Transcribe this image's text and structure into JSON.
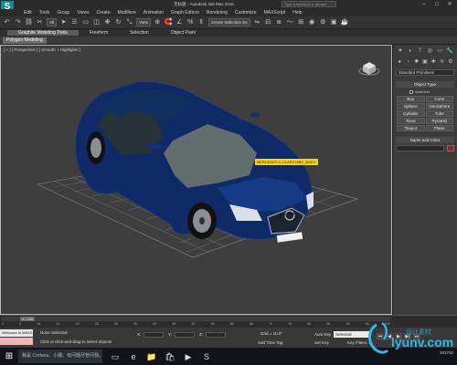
{
  "app": {
    "logo": "S",
    "title": "无标题 - Autodesk 3ds Max 2016",
    "search_placeholder": "Type a keyword or phrase",
    "window_buttons": [
      "–",
      "□",
      "✕"
    ]
  },
  "menu": [
    "Edit",
    "Tools",
    "Group",
    "Views",
    "Create",
    "Modifiers",
    "Animation",
    "Graph Editors",
    "Rendering",
    "Customize",
    "MAXScript",
    "Help"
  ],
  "toolbar": {
    "filter_select": "All",
    "refcoord_select": "View",
    "named_sel": "Create Selection Se"
  },
  "ribbon": {
    "tabs": [
      "Graphite Modeling Tools",
      "Freeform",
      "Selection",
      "Object Paint"
    ],
    "active_index": 0,
    "sub_panel": "Polygon Modeling"
  },
  "viewport": {
    "label": "[ + ] [ Perspective ] [ Smooth + Highlights ]",
    "car_tag": "MERCEDES C-CLASS MBC_BODY",
    "plate": "S·CL 6111"
  },
  "command_panel": {
    "category_dropdown": "Standard Primitives",
    "object_type_header": "Object Type",
    "autogrid_label": "AutoGrid",
    "objects": [
      "Box",
      "Cone",
      "Sphere",
      "GeoSphere",
      "Cylinder",
      "Tube",
      "Torus",
      "Pyramid",
      "Teapot",
      "Plane"
    ],
    "name_color_header": "Name and Color",
    "swatch_color": "#9a1b2c"
  },
  "timeline": {
    "frame_indicator": "0 / 100",
    "ticks": [
      "0",
      "5",
      "10",
      "15",
      "20",
      "25",
      "30",
      "35",
      "40",
      "45",
      "50",
      "55",
      "60",
      "65",
      "70",
      "75",
      "80",
      "85",
      "90",
      "95",
      "100"
    ]
  },
  "status": {
    "maxscript_in": "Welcome to MAXS",
    "maxscript_out": "",
    "selection_status": "None Selected",
    "prompt": "Click or click-and-drag to select objects",
    "x_label": "X:",
    "y_label": "Y:",
    "z_label": "Z:",
    "grid": "Grid = 10.0\"",
    "add_time_tag": "Add Time Tag",
    "auto_key": "Auto Key",
    "set_key": "Set Key",
    "selected_dropdown": "Selected",
    "key_filters": "Key Filters...",
    "play_controls": [
      "⏮",
      "◀",
      "▶",
      "▶|",
      "⏭"
    ]
  },
  "taskbar": {
    "start_icon": "⊞",
    "cortana": "我是 Cortana，小娜。有问题尽管问我。",
    "apps": [
      "▭",
      "e",
      "📁",
      "🛍",
      "▶",
      "S"
    ],
    "time": "",
    "date": "2017/4/"
  },
  "watermark": {
    "text": "lyunv.com",
    "subtitle": "设计素材",
    "accent": "#35b6e8"
  }
}
